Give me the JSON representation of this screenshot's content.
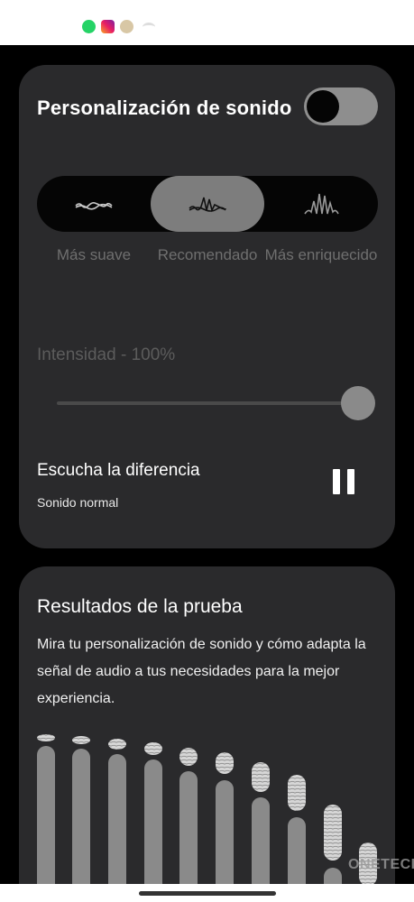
{
  "status_bar": {
    "app_icons": [
      "whatsapp-icon",
      "instagram-icon",
      "avatar-icon",
      "wifi-icon"
    ]
  },
  "sound_card": {
    "title": "Personalización de sonido",
    "toggle_on": false,
    "segments": [
      {
        "label": "Más suave",
        "icon": "soft-wave-icon",
        "selected": false
      },
      {
        "label": "Recomendado",
        "icon": "recommended-wave-icon",
        "selected": true
      },
      {
        "label": "Más enriquecido",
        "icon": "rich-wave-icon",
        "selected": false
      }
    ],
    "intensity_label": "Intensidad - 100%",
    "intensity_value": 100,
    "listen_title": "Escucha la diferencia",
    "listen_subtitle": "Sonido normal",
    "pause_icon": "pause-icon"
  },
  "results_card": {
    "title": "Resultados de la prueba",
    "description": "Mira tu personalización de sonido y cómo adapta la señal de audio a tus necesidades para la mejor experiencia."
  },
  "watermark": "ONETECH",
  "colors": {
    "background": "#000000",
    "card": "#2a2a2c",
    "accent_gray": "#7d7d7d",
    "muted_text": "#6f6f6f"
  }
}
